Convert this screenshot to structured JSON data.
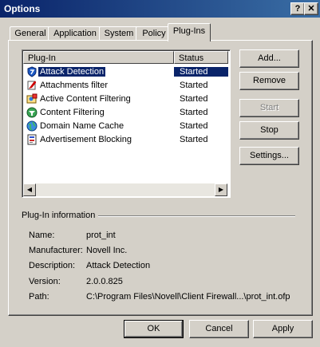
{
  "window": {
    "title": "Options",
    "help_glyph": "?",
    "close_glyph": "✕"
  },
  "tabs": [
    {
      "label": "General"
    },
    {
      "label": "Application"
    },
    {
      "label": "System"
    },
    {
      "label": "Policy"
    },
    {
      "label": "Plug-Ins",
      "active": true
    }
  ],
  "list": {
    "columns": [
      "Plug-In",
      "Status"
    ],
    "rows": [
      {
        "name": "Attack Detection",
        "status": "Started",
        "icon": "shield-icon",
        "selected": true
      },
      {
        "name": "Attachments filter",
        "status": "Started",
        "icon": "paperclip-icon"
      },
      {
        "name": "Active Content Filtering",
        "status": "Started",
        "icon": "active-content-icon"
      },
      {
        "name": "Content Filtering",
        "status": "Started",
        "icon": "content-filter-icon"
      },
      {
        "name": "Domain Name Cache",
        "status": "Started",
        "icon": "globe-icon"
      },
      {
        "name": "Advertisement Blocking",
        "status": "Started",
        "icon": "ad-block-icon"
      }
    ]
  },
  "side_buttons": {
    "add": "Add...",
    "remove": "Remove",
    "start": "Start",
    "stop": "Stop",
    "settings": "Settings..."
  },
  "info": {
    "group_label": "Plug-In information",
    "name_label": "Name:",
    "name": "prot_int",
    "manufacturer_label": "Manufacturer:",
    "manufacturer": "Novell Inc.",
    "description_label": "Description:",
    "description": "Attack Detection",
    "version_label": "Version:",
    "version": "2.0.0.825",
    "path_label": "Path:",
    "path": "C:\\Program Files\\Novell\\Client Firewall...\\prot_int.ofp"
  },
  "footer": {
    "ok": "OK",
    "cancel": "Cancel",
    "apply": "Apply"
  },
  "colors": {
    "titlebar_start": "#0a246a",
    "titlebar_end": "#3a6ea5",
    "selection": "#0a246a",
    "face": "#d4d0c8"
  }
}
